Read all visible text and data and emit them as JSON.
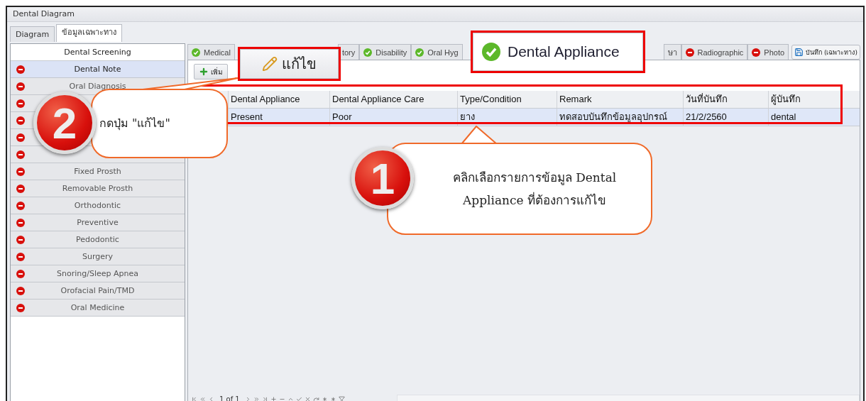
{
  "window": {
    "title": "Dental Diagram"
  },
  "outer_tabs": [
    {
      "label": "Diagram",
      "selected": false
    },
    {
      "label": "ข้อมูลเฉพาะทาง",
      "selected": true
    }
  ],
  "sidebar": {
    "header": "Dental Screening",
    "items": [
      {
        "label": "Dental Note",
        "selected": true,
        "complete": false
      },
      {
        "label": "Oral Diagnosis",
        "selected": false,
        "complete": false
      },
      {
        "selected": false,
        "complete": false
      },
      {
        "selected": false,
        "complete": false
      },
      {
        "selected": false,
        "complete": false
      },
      {
        "selected": false,
        "complete": false
      },
      {
        "label": "Fixed Prosth",
        "selected": false,
        "complete": false
      },
      {
        "label": "Removable Prosth",
        "selected": false,
        "complete": false
      },
      {
        "label": "Orthodontic",
        "selected": false,
        "complete": false
      },
      {
        "label": "Preventive",
        "selected": false,
        "complete": false
      },
      {
        "label": "Pedodontic",
        "selected": false,
        "complete": false
      },
      {
        "label": "Surgery",
        "selected": false,
        "complete": false
      },
      {
        "label": "Snoring/Sleep Apnea",
        "selected": false,
        "complete": false
      },
      {
        "label": "Orofacial Pain/TMD",
        "selected": false,
        "complete": false
      },
      {
        "label": "Oral Medicine",
        "selected": false,
        "complete": false
      }
    ]
  },
  "tabs": [
    {
      "label": "Medical",
      "complete": true
    },
    {
      "label": "tory"
    },
    {
      "label": "Disability",
      "complete": true
    },
    {
      "label": "Oral Hyg",
      "complete": true
    },
    {
      "label": "ษา"
    },
    {
      "label": "Radiographic",
      "complete": false
    },
    {
      "label": "Photo",
      "complete": false
    }
  ],
  "save_button": "บันทึก (เฉพาะทาง)",
  "add_button": "เพิ่ม",
  "grid": {
    "columns": [
      "Dental Appliance",
      "Dental Appliance Care",
      "Type/Condition",
      "Remark",
      "วันที่บันทึก",
      "ผู้บันทึก"
    ],
    "rows": [
      {
        "selected": true,
        "cells": [
          "Present",
          "Poor",
          "ยาง",
          "ทดสอบบันทึกข้อมูลอุปกรณ์",
          "21/2/2560",
          "dental"
        ]
      }
    ]
  },
  "navigator": {
    "position": "1 of 1"
  },
  "popups": {
    "edit_button": "แก้ไข",
    "appliance_tab": "Dental Appliance"
  },
  "callouts": [
    {
      "number": "1",
      "text": "คลิกเลือกรายการข้อมูล Dental Appliance ที่ต้องการแก้ไข"
    },
    {
      "number": "2",
      "text": "กดปุ่ม \"แก้ไข\""
    }
  ]
}
